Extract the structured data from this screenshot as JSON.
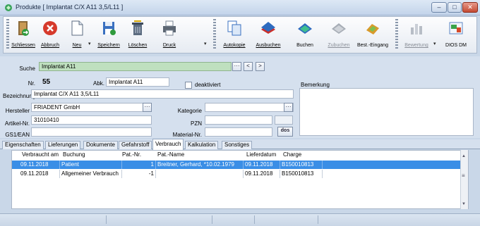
{
  "window": {
    "title": "Produkte [ Implantat C/X A11 3,5/L11 ]",
    "min": "–",
    "max": "□",
    "close": "✕"
  },
  "toolbar": {
    "schliessen": "Schliessen",
    "abbruch": "Abbruch",
    "neu": "Neu",
    "speichern": "Speichern",
    "loeschen": "Löschen",
    "druck": "Druck",
    "autokopie": "Autokopie",
    "ausbuchen": "Ausbuchen",
    "buchen": "Buchen",
    "zubuchen": "Zubuchen",
    "best_eingang": "Best.-Eingang",
    "bewertung": "Bewertung",
    "dios_dm": "DIOS DM",
    "dropdown": "▾"
  },
  "search": {
    "label": "Suche",
    "value": "Implantat A11",
    "dots": "···",
    "prev": "<",
    "next": ">"
  },
  "form": {
    "nr_label": "Nr.",
    "nr_value": "55",
    "abk_label": "Abk.",
    "abk_value": "Implantat A11",
    "deaktiviert_label": "deaktiviert",
    "bemerkung_label": "Bemerkung",
    "bezeichnung_label": "Bezeichnung",
    "bezeichnung_value": "Implantat C/X A11 3,5/L11",
    "hersteller_label": "Hersteller",
    "hersteller_value": "FRIADENT GmbH",
    "kategorie_label": "Kategorie",
    "kategorie_value": "",
    "artikel_label": "Artikel-Nr.",
    "artikel_value": "31010410",
    "pzn_label": "PZN",
    "pzn_value": "",
    "gs1_label": "GS1/EAN",
    "gs1_value": "",
    "material_label": "Material-Nr.",
    "material_value": "",
    "dots": "···",
    "dos_btn": "dos"
  },
  "tabs": [
    "Eigenschaften",
    "Lieferungen",
    "Dokumente",
    "Gefahrstoff",
    "Verbrauch",
    "Kalkulation",
    "Sonstiges"
  ],
  "grid": {
    "headers": [
      "Verbraucht am",
      "Buchung",
      "Pat.-Nr.",
      "Pat.-Name",
      "Lieferdatum",
      "Charge"
    ],
    "rows": [
      [
        "09.11.2018",
        "Patient",
        "1",
        "Breitner, Gerhard, *10.02.1979",
        "09.11.2018",
        "B150010813"
      ],
      [
        "09.11.2018",
        "Allgemeiner Verbrauch",
        "-1",
        "",
        "09.11.2018",
        "B150010813"
      ]
    ],
    "row_marker": "▶",
    "scroll_up": "▲",
    "scroll_grip": "≡",
    "scroll_down": "▼"
  }
}
